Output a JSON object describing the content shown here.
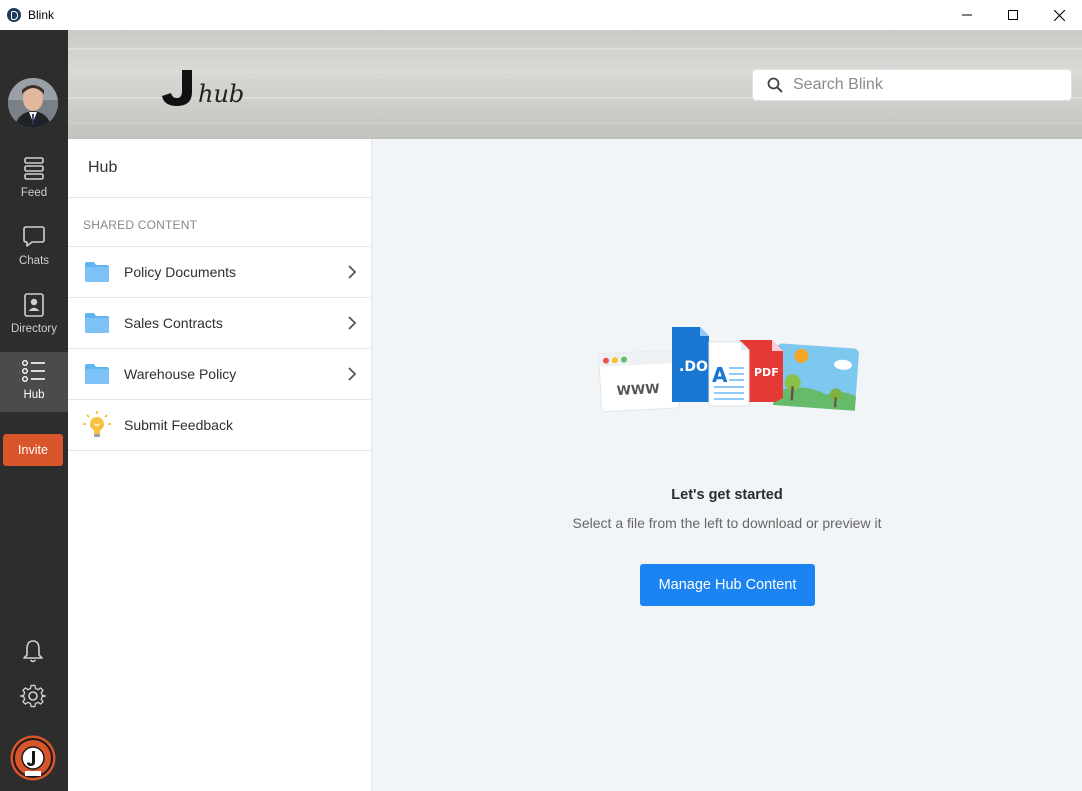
{
  "window": {
    "title": "Blink",
    "controls": [
      "minimize-icon",
      "maximize-icon",
      "close-icon"
    ]
  },
  "rail": {
    "items": [
      {
        "label": "Feed",
        "icon": "feed-icon"
      },
      {
        "label": "Chats",
        "icon": "chat-bubble-icon"
      },
      {
        "label": "Directory",
        "icon": "contact-card-icon"
      },
      {
        "label": "Hub",
        "icon": "list-icon",
        "active": true
      }
    ],
    "invite_label": "Invite",
    "bottom_icons": [
      "bell-icon",
      "gear-icon"
    ]
  },
  "header": {
    "search_placeholder": "Search Blink"
  },
  "panel": {
    "title": "Hub",
    "section_label": "SHARED CONTENT",
    "items": [
      {
        "label": "Policy Documents",
        "icon": "folder-icon"
      },
      {
        "label": "Sales Contracts",
        "icon": "folder-icon"
      },
      {
        "label": "Warehouse Policy",
        "icon": "folder-icon"
      },
      {
        "label": "Submit Feedback",
        "icon": "lightbulb-icon"
      }
    ]
  },
  "main": {
    "illustration_labels": {
      "www": "WWW",
      "doc": ".DOC",
      "a": "A",
      "pdf": "PDF"
    },
    "title": "Let's get started",
    "subtitle": "Select a file from the left to download or preview it",
    "button_label": "Manage Hub Content"
  },
  "colors": {
    "rail_bg": "#2c2d2c",
    "rail_active": "#4a4b4b",
    "invite": "#d8552b",
    "primary": "#1b83f2",
    "main_bg": "#f2f5f8",
    "folder": "#5fb4f2"
  }
}
